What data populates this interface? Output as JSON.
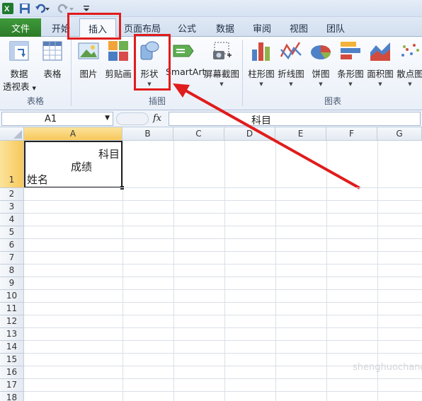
{
  "tabs": {
    "file": "文件",
    "home": "开始",
    "insert": "插入",
    "page_layout": "页面布局",
    "formulas": "公式",
    "data": "数据",
    "review": "审阅",
    "view": "视图",
    "team": "团队"
  },
  "ribbon": {
    "tables": {
      "pivot_line1": "数据",
      "pivot_line2": "透视表",
      "table": "表格",
      "group": "表格"
    },
    "illustrations": {
      "picture": "图片",
      "clipart": "剪贴画",
      "shapes": "形状",
      "smartart": "SmartArt",
      "screenshot": "屏幕截图",
      "group": "插图"
    },
    "charts": {
      "column": "柱形图",
      "line": "折线图",
      "pie": "饼图",
      "bar": "条形图",
      "area": "面积图",
      "scatter": "散点图",
      "group": "图表"
    },
    "dropdown_arrow": "▼"
  },
  "formula_bar": {
    "name_box": "A1",
    "fx": "fx",
    "content": "科目"
  },
  "columns": [
    "A",
    "B",
    "C",
    "D",
    "E",
    "F",
    "G"
  ],
  "rows": [
    "1",
    "2",
    "3",
    "4",
    "5",
    "6",
    "7",
    "8",
    "9",
    "10",
    "11",
    "12",
    "13",
    "14",
    "15",
    "16",
    "17",
    "18"
  ],
  "cell_a1": {
    "line1": "科目",
    "line2": "成绩",
    "line3": "姓名"
  },
  "colors": {
    "highlight_red": "#e01c1c",
    "file_tab_green": "#2b7a28",
    "selected_header": "#f7c85a"
  },
  "watermark": "shenghuochangshi"
}
